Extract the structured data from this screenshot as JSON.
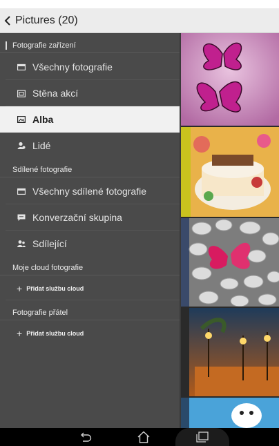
{
  "header": {
    "title": "Pictures (20)"
  },
  "drawer": {
    "sections": [
      {
        "label": "Fotografie zařízení"
      },
      {
        "label": "Sdílené fotografie"
      },
      {
        "label": "Moje cloud fotografie"
      },
      {
        "label": "Fotografie přátel"
      }
    ],
    "device_items": [
      {
        "label": "Všechny fotografie",
        "icon": "gallery-icon"
      },
      {
        "label": "Stěna akcí",
        "icon": "event-wall-icon"
      },
      {
        "label": "Alba",
        "icon": "album-icon",
        "selected": true
      },
      {
        "label": "Lidé",
        "icon": "people-icon"
      }
    ],
    "shared_items": [
      {
        "label": "Všechny sdílené fotografie",
        "icon": "shared-gallery-icon"
      },
      {
        "label": "Konverzační skupina",
        "icon": "chat-icon"
      },
      {
        "label": "Sdílející",
        "icon": "sharers-icon"
      }
    ],
    "cloud_add": {
      "label": "Přidat službu cloud"
    },
    "friends_add": {
      "label": "Přidat službu cloud"
    }
  },
  "navbar": {
    "back": "back-icon",
    "home": "home-icon",
    "recent": "recent-apps-icon"
  },
  "colors": {
    "drawer_bg": "#4a4a4a",
    "selected_bg": "#f1f1f1",
    "header_bg": "#ececec"
  }
}
